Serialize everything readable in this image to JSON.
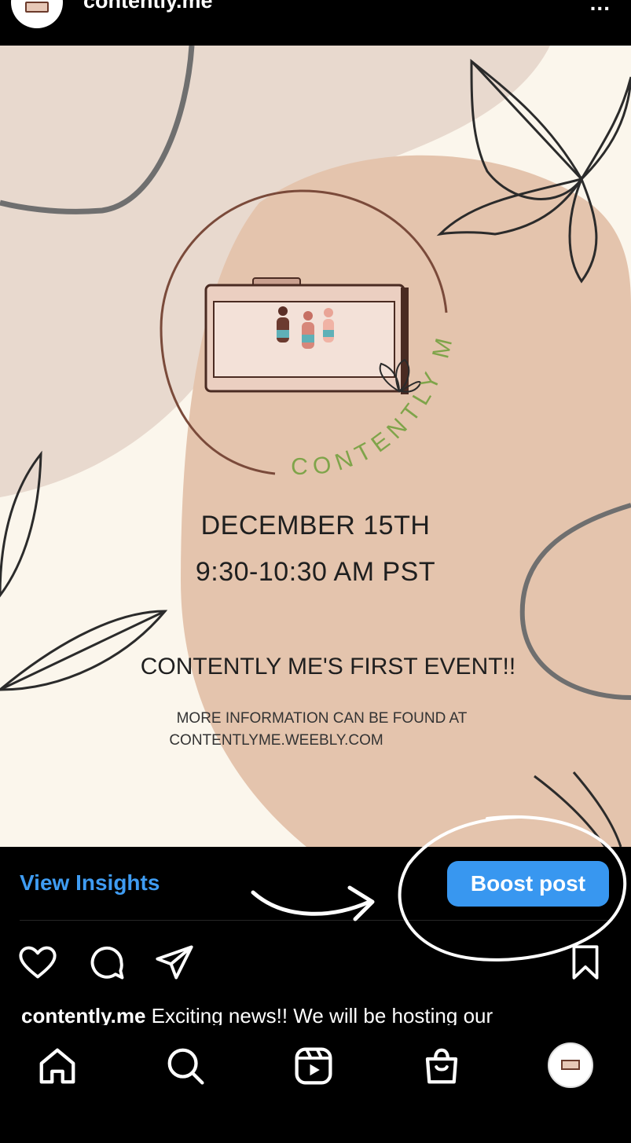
{
  "header": {
    "username": "contently.me",
    "more_label": "..."
  },
  "post_image": {
    "logo_text": "CONTENTLY ME",
    "date": "DECEMBER 15TH",
    "time": "9:30-10:30 AM PST",
    "event_title": "CONTENTLY ME'S FIRST EVENT!!",
    "info_line1": "MORE INFORMATION CAN BE FOUND AT",
    "info_line2": "CONTENTLYME.WEEBLY.COM"
  },
  "insights": {
    "view_insights_label": "View Insights",
    "boost_label": "Boost post"
  },
  "actions": [
    "heart-icon",
    "comment-icon",
    "share-icon",
    "bookmark-icon"
  ],
  "caption": {
    "username": "contently.me",
    "text": " Exciting news!! We will be hosting our"
  },
  "nav": {
    "items": [
      "home-icon",
      "search-icon",
      "reels-icon",
      "shop-icon",
      "profile-avatar"
    ]
  },
  "colors": {
    "link": "#3f9cf2",
    "button": "#3897f0",
    "background": "#000000",
    "post_bg": "#fbf6ec",
    "beige": "#e4c4ad"
  }
}
